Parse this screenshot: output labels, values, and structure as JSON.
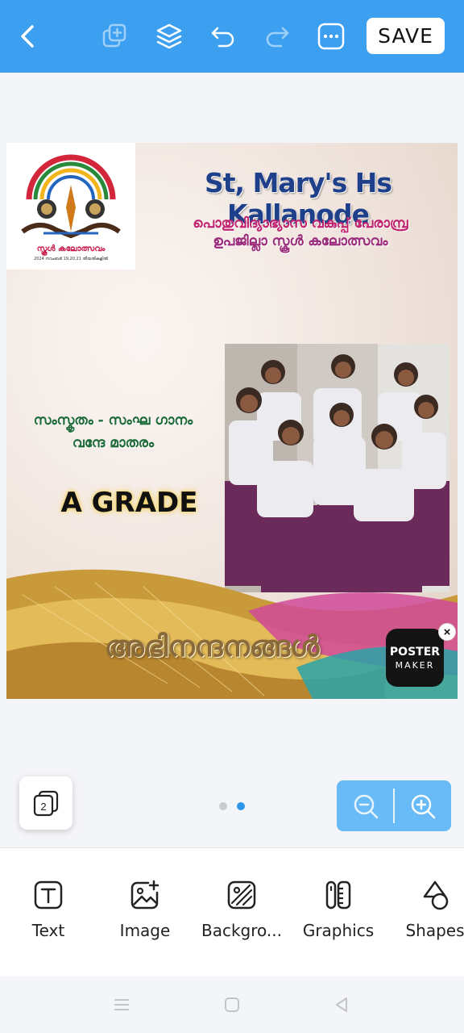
{
  "toolbar": {
    "save_label": "SAVE",
    "icons": [
      "back-icon",
      "duplicate-icon",
      "layers-icon",
      "undo-icon",
      "redo-icon",
      "more-icon"
    ]
  },
  "poster": {
    "logo_text_main": "സ്കൂൾ കലോത്സവം",
    "logo_text_small": "2024 നവംബർ 19,20,21 തീയതികളിൽ",
    "school_name": "St, Mary's Hs Kallanode",
    "subtitle_line1": "പൊതുവിദ്യാഭ്യാസ വകുപ്പ് പേരാമ്പ്ര",
    "subtitle_line2": "ഉപജില്ലാ സ്കൂൾ കലോത്സവം",
    "event_line1": "സംസ്കൃതം - സംഘ ഗാനം",
    "event_line2": "വന്ദേ മാതരം",
    "grade": "A GRADE",
    "greeting": "അഭിനന്ദനങ്ങൾ",
    "badge_line1": "POSTER",
    "badge_line2": "MAKER",
    "badge_close": "×"
  },
  "pager": {
    "page_count": "2",
    "total_dots": 2,
    "active_dot": 2
  },
  "tools": [
    {
      "label": "Text",
      "icon": "text-icon"
    },
    {
      "label": "Image",
      "icon": "add-image-icon"
    },
    {
      "label": "Backgro...",
      "icon": "background-icon"
    },
    {
      "label": "Graphics",
      "icon": "graphics-icon"
    },
    {
      "label": "Shapes",
      "icon": "shapes-icon"
    }
  ],
  "colors": {
    "accent": "#3d9ff0",
    "zoom_bg": "#68bbf7",
    "dot_active": "#2f95ea",
    "dot_inactive": "#c9cbd0",
    "school_name": "#1e3f8a",
    "subtitle": "#c0246f",
    "event": "#1f6b3a"
  }
}
